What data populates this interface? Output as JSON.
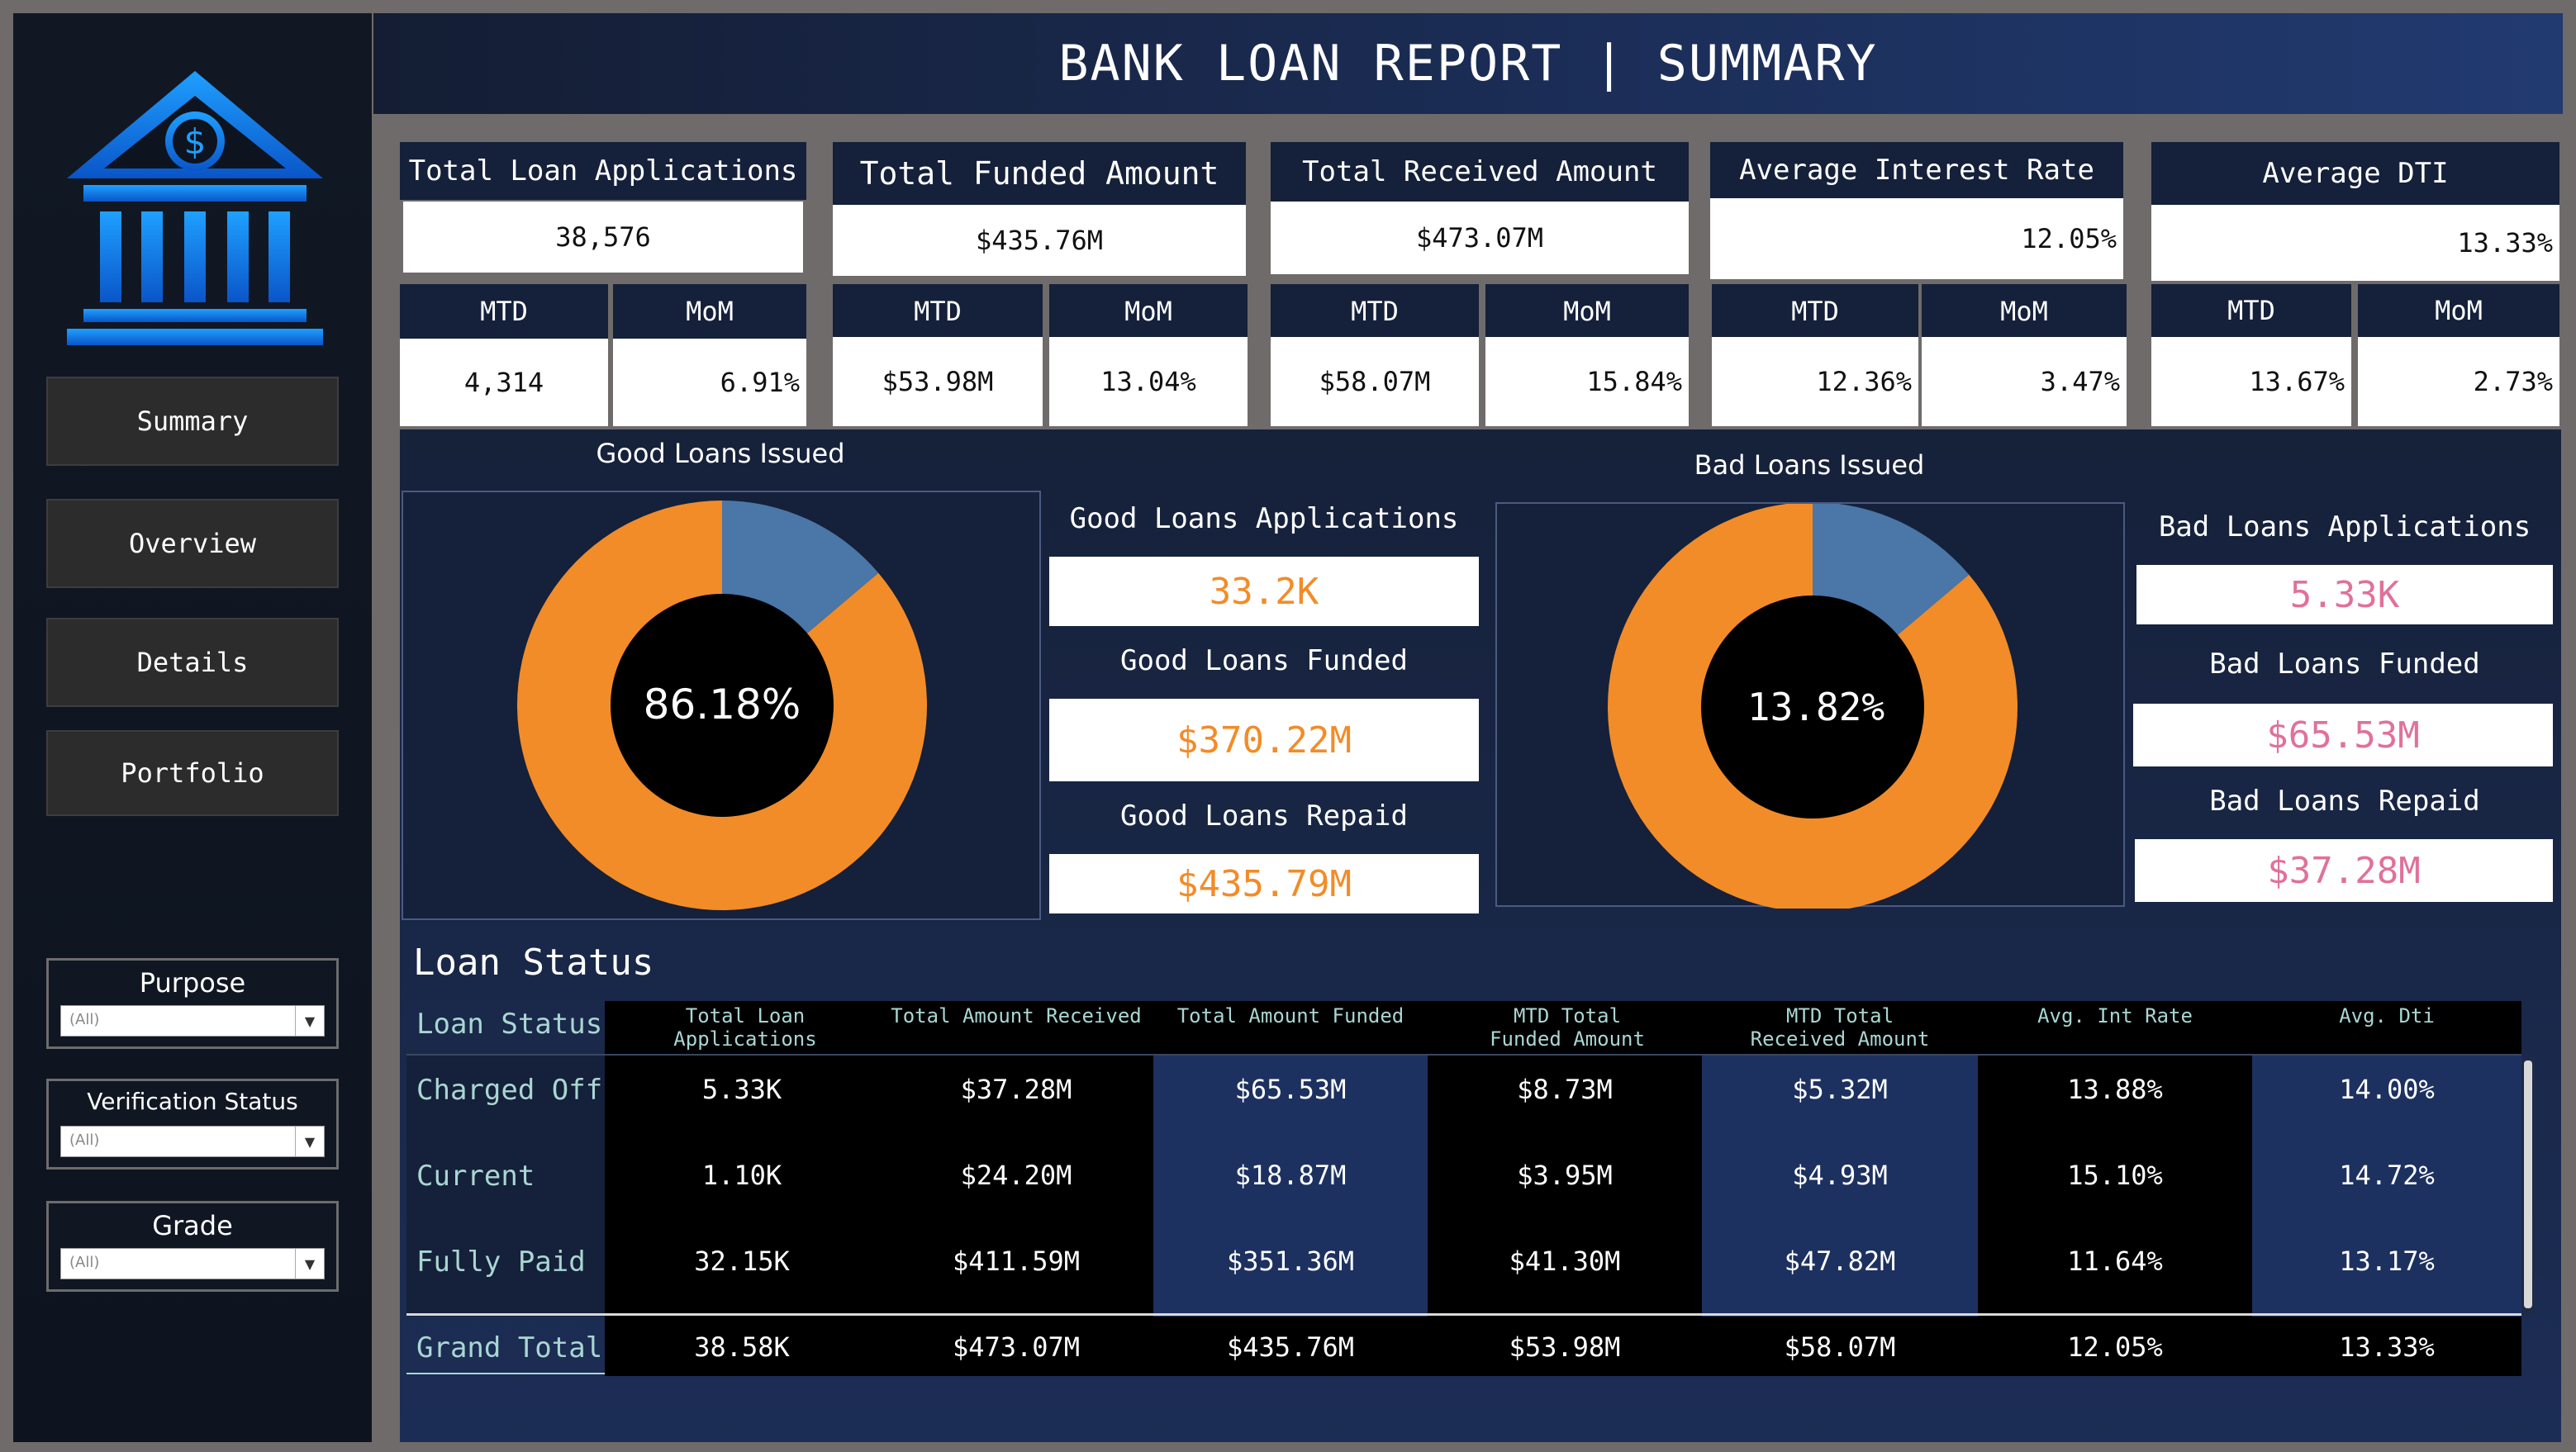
{
  "header": {
    "title": "BANK LOAN REPORT | SUMMARY"
  },
  "sidebar": {
    "logo_icon": "bank-dollar-icon",
    "nav": [
      {
        "label": "Summary"
      },
      {
        "label": "Overview"
      },
      {
        "label": "Details"
      },
      {
        "label": "Portfolio"
      }
    ],
    "filters": [
      {
        "title": "Purpose",
        "value": "(All)"
      },
      {
        "title": "Verification Status",
        "value": "(All)"
      },
      {
        "title": "Grade",
        "value": "(All)"
      }
    ]
  },
  "kpis": [
    {
      "title": "Total Loan Applications",
      "value": "38,576",
      "mtd_label": "MTD",
      "mtd": "4,314",
      "mom_label": "MoM",
      "mom": "6.91%"
    },
    {
      "title": "Total Funded Amount",
      "value": "$435.76M",
      "mtd_label": "MTD",
      "mtd": "$53.98M",
      "mom_label": "MoM",
      "mom": "13.04%"
    },
    {
      "title": "Total Received Amount",
      "value": "$473.07M",
      "mtd_label": "MTD",
      "mtd": "$58.07M",
      "mom_label": "MoM",
      "mom": "15.84%"
    },
    {
      "title": "Average Interest Rate",
      "value": "12.05%",
      "mtd_label": "MTD",
      "mtd": "12.36%",
      "mom_label": "MoM",
      "mom": "3.47%"
    },
    {
      "title": "Average DTI",
      "value": "13.33%",
      "mtd_label": "MTD",
      "mtd": "13.67%",
      "mom_label": "MoM",
      "mom": "2.73%"
    }
  ],
  "good_loans": {
    "chart_title": "Good Loans Issued",
    "percent_label": "86.18%",
    "percent": 86.18,
    "applications_label": "Good Loans Applications",
    "applications": "33.2K",
    "funded_label": "Good Loans Funded",
    "funded": "$370.22M",
    "repaid_label": "Good Loans Repaid",
    "repaid": "$435.79M"
  },
  "bad_loans": {
    "chart_title": "Bad Loans Issued",
    "percent_label": "13.82%",
    "percent": 13.82,
    "applications_label": "Bad Loans Applications",
    "applications": "5.33K",
    "funded_label": "Bad Loans Funded",
    "funded": "$65.53M",
    "repaid_label": "Bad Loans Repaid",
    "repaid": "$37.28M"
  },
  "colors": {
    "orange": "#f28c28",
    "blue": "#4a76a8",
    "pink": "#e0719a",
    "navy": "#15203a"
  },
  "loan_status_table": {
    "title": "Loan Status",
    "columns": [
      "Loan Status",
      "Total Loan Applications",
      "Total Amount Received",
      "Total Amount Funded",
      "MTD Total Funded Amount",
      "MTD Total Received Amount",
      "Avg. Int Rate",
      "Avg. Dti"
    ],
    "rows": [
      [
        "Charged Off",
        "5.33K",
        "$37.28M",
        "$65.53M",
        "$8.73M",
        "$5.32M",
        "13.88%",
        "14.00%"
      ],
      [
        "Current",
        "1.10K",
        "$24.20M",
        "$18.87M",
        "$3.95M",
        "$4.93M",
        "15.10%",
        "14.72%"
      ],
      [
        "Fully Paid",
        "32.15K",
        "$411.59M",
        "$351.36M",
        "$41.30M",
        "$47.82M",
        "11.64%",
        "13.17%"
      ]
    ],
    "total": [
      "Grand Total",
      "38.58K",
      "$473.07M",
      "$435.76M",
      "$53.98M",
      "$58.07M",
      "12.05%",
      "13.33%"
    ]
  }
}
